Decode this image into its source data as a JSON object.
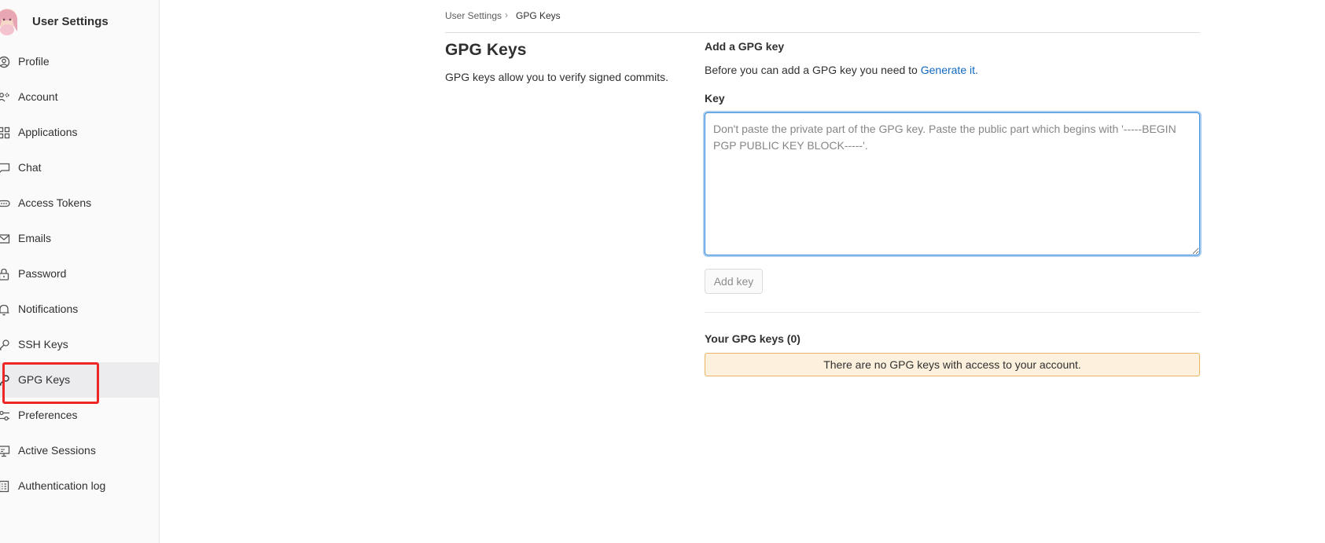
{
  "sidebar": {
    "title": "User Settings",
    "items": [
      {
        "label": "Profile",
        "icon": "profile-icon"
      },
      {
        "label": "Account",
        "icon": "account-icon"
      },
      {
        "label": "Applications",
        "icon": "applications-icon"
      },
      {
        "label": "Chat",
        "icon": "chat-icon"
      },
      {
        "label": "Access Tokens",
        "icon": "token-icon"
      },
      {
        "label": "Emails",
        "icon": "mail-icon"
      },
      {
        "label": "Password",
        "icon": "lock-icon"
      },
      {
        "label": "Notifications",
        "icon": "bell-icon"
      },
      {
        "label": "SSH Keys",
        "icon": "key-icon"
      },
      {
        "label": "GPG Keys",
        "icon": "gpg-key-icon",
        "active": true
      },
      {
        "label": "Preferences",
        "icon": "preferences-icon"
      },
      {
        "label": "Active Sessions",
        "icon": "monitor-icon"
      },
      {
        "label": "Authentication log",
        "icon": "log-icon"
      }
    ]
  },
  "breadcrumb": {
    "parent": "User Settings",
    "separator": "›",
    "current": "GPG Keys"
  },
  "page": {
    "title": "GPG Keys",
    "description": "GPG keys allow you to verify signed commits."
  },
  "add_form": {
    "title": "Add a GPG key",
    "description_prefix": "Before you can add a GPG key you need to ",
    "description_link": "Generate it.",
    "key_label": "Key",
    "key_value": "",
    "key_placeholder": "Don't paste the private part of the GPG key. Paste the public part which begins with '-----BEGIN PGP PUBLIC KEY BLOCK-----'.",
    "submit_label": "Add key"
  },
  "keys_list": {
    "title": "Your GPG keys (0)",
    "empty_message": "There are no GPG keys with access to your account."
  },
  "colors": {
    "link": "#1068bf",
    "focus_border": "#428fdc",
    "alert_bg": "#fdf1dd",
    "alert_border": "#e9b463",
    "highlight": "#ef2626"
  }
}
